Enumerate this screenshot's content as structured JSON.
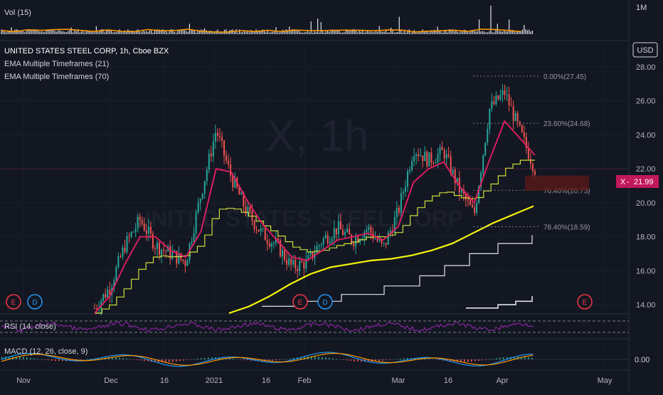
{
  "volume_pane": {
    "label": "Vol (15)",
    "scale_label": "1M",
    "ma_color": "#ff9800",
    "bar_color": "#e0e3eb"
  },
  "legend": {
    "symbol_line": "UNITED STATES STEEL CORP, 1h, Cboe BZX",
    "ema_short": "EMA Multiple Timeframes (21)",
    "ema_long": "EMA Multiple Timeframes (70)"
  },
  "watermark": {
    "symbol": "X, 1h",
    "name": "UNITED STATES STEEL CORP"
  },
  "currency_label": "USD",
  "last_price": {
    "ticker": "X",
    "value": "21.99",
    "value_num": 21.99,
    "color": "#c2185b"
  },
  "fib_labels": [
    {
      "text": "0.00%(27.45)",
      "value": 27.45
    },
    {
      "text": "23.60%(24.68)",
      "value": 24.68
    },
    {
      "text": "76.40%(20.73)",
      "value": 20.73
    },
    {
      "text": "78.40%(18.59)",
      "value": 18.59
    }
  ],
  "event_markers": [
    {
      "letter": "E",
      "type": "earnings",
      "x_label": "Oct end"
    },
    {
      "letter": "D",
      "type": "dividend",
      "x_label": "Nov start"
    },
    {
      "letter": "E",
      "type": "earnings",
      "x_label": "Jan end"
    },
    {
      "letter": "D",
      "type": "dividend",
      "x_label": "Feb start"
    },
    {
      "letter": "E",
      "type": "earnings",
      "x_label": "Apr end"
    }
  ],
  "rsi_pane": {
    "label": "RSI (14, close)",
    "line_color": "#9c27b0",
    "levels": [
      70,
      30
    ]
  },
  "macd_pane": {
    "label": "MACD (12, 26, close, 9)",
    "scale_label": "0.00",
    "macd_color": "#2196f3",
    "signal_color": "#ff9800"
  },
  "colors": {
    "up": "#26a69a",
    "down": "#ef5350",
    "ema21": "#e91e63",
    "ema70": "#cddc39",
    "ema_daily": "#f5f50a",
    "ema_weekly": "#e0e3eb"
  },
  "chart_data": {
    "type": "line",
    "title": "UNITED STATES STEEL CORP, 1h, Cboe BZX",
    "xlabel": "",
    "ylabel": "",
    "x_tick_labels": [
      "Nov",
      "Dec",
      "16",
      "2021",
      "16",
      "Feb",
      "Mar",
      "16",
      "Apr",
      "May"
    ],
    "y_tick_labels": [
      "14.00",
      "16.00",
      "18.00",
      "20.00",
      "22.00",
      "24.00",
      "26.00",
      "28.00"
    ],
    "ylim": [
      13.5,
      29.5
    ],
    "x": [
      "Nov 27",
      "Dec 3",
      "Dec 8",
      "Dec 14",
      "Dec 18",
      "Dec 23",
      "Dec 29",
      "Jan 4",
      "Jan 8",
      "Jan 12",
      "Jan 15",
      "Jan 20",
      "Jan 25",
      "Jan 29",
      "Feb 3",
      "Feb 8",
      "Feb 12",
      "Feb 18",
      "Feb 23",
      "Feb 26",
      "Mar 3",
      "Mar 8",
      "Mar 11",
      "Mar 16",
      "Mar 19",
      "Mar 24",
      "Mar 29",
      "Apr 1",
      "Apr 6",
      "Apr 9"
    ],
    "series": [
      {
        "name": "price",
        "values": [
          13.8,
          15.0,
          17.5,
          19.0,
          17.5,
          17.0,
          16.5,
          20.5,
          24.3,
          21.5,
          19.5,
          18.2,
          17.5,
          16.2,
          16.5,
          17.8,
          18.5,
          17.8,
          18.5,
          17.3,
          19.5,
          23.2,
          22.5,
          23.0,
          20.8,
          19.3,
          25.5,
          26.5,
          24.2,
          21.99
        ]
      },
      {
        "name": "EMA (21)",
        "values": [
          13.5,
          14.5,
          16.4,
          18.0,
          18.0,
          17.2,
          16.8,
          18.3,
          22.0,
          21.8,
          20.2,
          18.8,
          17.8,
          16.8,
          16.6,
          17.2,
          17.8,
          18.0,
          18.2,
          17.8,
          18.6,
          21.2,
          22.0,
          22.4,
          21.0,
          20.0,
          22.5,
          24.8,
          23.8,
          22.8
        ]
      },
      {
        "name": "EMA (70)",
        "values": [
          13.5,
          14.0,
          15.0,
          16.2,
          16.9,
          16.8,
          16.9,
          17.6,
          19.6,
          19.7,
          19.3,
          18.7,
          18.1,
          17.4,
          17.1,
          17.2,
          17.5,
          17.7,
          18.0,
          18.0,
          18.3,
          19.5,
          20.3,
          20.7,
          20.3,
          20.2,
          21.0,
          22.0,
          22.5,
          22.5
        ]
      }
    ]
  }
}
